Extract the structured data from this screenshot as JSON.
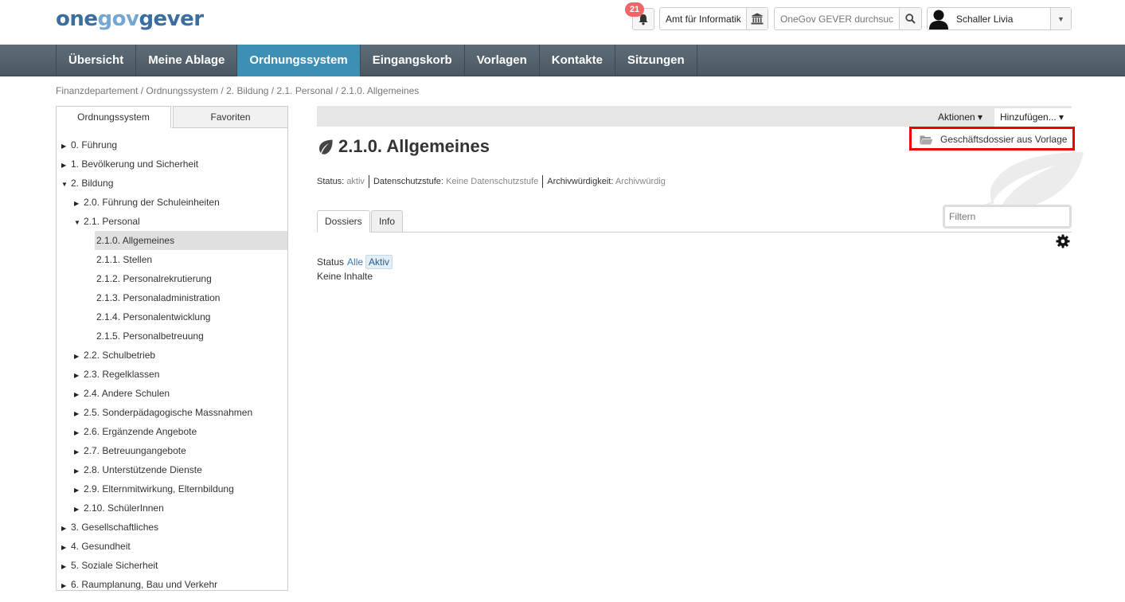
{
  "header": {
    "logo": {
      "part1": "one",
      "part2": "gov",
      "part3": "gever"
    },
    "notification_count": "21",
    "org_unit": "Amt für Informatik",
    "search_placeholder": "OneGov GEVER durchsuc",
    "user_name": "Schaller Livia"
  },
  "nav": {
    "items": [
      {
        "label": "Übersicht",
        "active": false
      },
      {
        "label": "Meine Ablage",
        "active": false
      },
      {
        "label": "Ordnungssystem",
        "active": true
      },
      {
        "label": "Eingangskorb",
        "active": false
      },
      {
        "label": "Vorlagen",
        "active": false
      },
      {
        "label": "Kontakte",
        "active": false
      },
      {
        "label": "Sitzungen",
        "active": false
      }
    ]
  },
  "breadcrumb": "Finanzdepartement / Ordnungssystem / 2. Bildung / 2.1. Personal / 2.1.0. Allgemeines",
  "sidebar": {
    "tabs": [
      "Ordnungssystem",
      "Favoriten"
    ],
    "tree": [
      {
        "label": "0. Führung",
        "level": 0,
        "caret": "right"
      },
      {
        "label": "1. Bevölkerung und Sicherheit",
        "level": 0,
        "caret": "right"
      },
      {
        "label": "2. Bildung",
        "level": 0,
        "caret": "down"
      },
      {
        "label": "2.0. Führung der Schuleinheiten",
        "level": 1,
        "caret": "right"
      },
      {
        "label": "2.1. Personal",
        "level": 1,
        "caret": "down"
      },
      {
        "label": "2.1.0. Allgemeines",
        "level": 2,
        "caret": "none",
        "selected": true
      },
      {
        "label": "2.1.1. Stellen",
        "level": 2,
        "caret": "none"
      },
      {
        "label": "2.1.2. Personalrekrutierung",
        "level": 2,
        "caret": "none"
      },
      {
        "label": "2.1.3. Personaladministration",
        "level": 2,
        "caret": "none"
      },
      {
        "label": "2.1.4. Personalentwicklung",
        "level": 2,
        "caret": "none"
      },
      {
        "label": "2.1.5. Personalbetreuung",
        "level": 2,
        "caret": "none"
      },
      {
        "label": "2.2. Schulbetrieb",
        "level": 1,
        "caret": "right"
      },
      {
        "label": "2.3. Regelklassen",
        "level": 1,
        "caret": "right"
      },
      {
        "label": "2.4. Andere Schulen",
        "level": 1,
        "caret": "right"
      },
      {
        "label": "2.5. Sonderpädagogische Massnahmen",
        "level": 1,
        "caret": "right"
      },
      {
        "label": "2.6. Ergänzende Angebote",
        "level": 1,
        "caret": "right"
      },
      {
        "label": "2.7. Betreuungangebote",
        "level": 1,
        "caret": "right"
      },
      {
        "label": "2.8. Unterstützende Dienste",
        "level": 1,
        "caret": "right"
      },
      {
        "label": "2.9. Elternmitwirkung, Elternbildung",
        "level": 1,
        "caret": "right"
      },
      {
        "label": "2.10. SchülerInnen",
        "level": 1,
        "caret": "right"
      },
      {
        "label": "3. Gesellschaftliches",
        "level": 0,
        "caret": "right"
      },
      {
        "label": "4. Gesundheit",
        "level": 0,
        "caret": "right"
      },
      {
        "label": "5. Soziale Sicherheit",
        "level": 0,
        "caret": "right"
      },
      {
        "label": "6. Raumplanung, Bau und Verkehr",
        "level": 0,
        "caret": "right"
      }
    ]
  },
  "toolbar": {
    "actions_label": "Aktionen ▾",
    "add_label": "Hinzufügen... ▾",
    "dropdown_item": "Geschäftsdossier aus Vorlage"
  },
  "page": {
    "title": "2.1.0. Allgemeines",
    "meta": {
      "status_label": "Status:",
      "status_value": "aktiv",
      "privacy_label": "Datenschutzstufe:",
      "privacy_value": "Keine Datenschutzstufe",
      "archival_label": "Archivwürdigkeit:",
      "archival_value": "Archivwürdig"
    },
    "tabs": [
      "Dossiers",
      "Info"
    ],
    "filter_placeholder": "Filtern",
    "status_filter": {
      "label": "Status",
      "all": "Alle",
      "active": "Aktiv"
    },
    "empty_text": "Keine Inhalte"
  },
  "colors": {
    "nav_active": "#3d8fb3",
    "highlight_border": "#e00000",
    "link": "#3a78b5"
  }
}
